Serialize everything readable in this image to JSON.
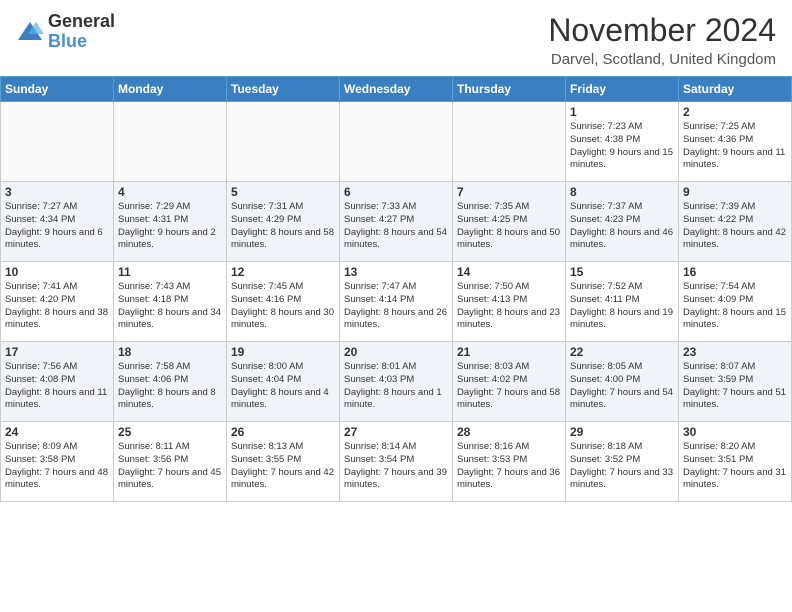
{
  "header": {
    "logo_line1": "General",
    "logo_line2": "Blue",
    "title": "November 2024",
    "location": "Darvel, Scotland, United Kingdom"
  },
  "weekdays": [
    "Sunday",
    "Monday",
    "Tuesday",
    "Wednesday",
    "Thursday",
    "Friday",
    "Saturday"
  ],
  "weeks": [
    [
      {
        "date": "",
        "info": ""
      },
      {
        "date": "",
        "info": ""
      },
      {
        "date": "",
        "info": ""
      },
      {
        "date": "",
        "info": ""
      },
      {
        "date": "",
        "info": ""
      },
      {
        "date": "1",
        "info": "Sunrise: 7:23 AM\nSunset: 4:38 PM\nDaylight: 9 hours and 15 minutes."
      },
      {
        "date": "2",
        "info": "Sunrise: 7:25 AM\nSunset: 4:36 PM\nDaylight: 9 hours and 11 minutes."
      }
    ],
    [
      {
        "date": "3",
        "info": "Sunrise: 7:27 AM\nSunset: 4:34 PM\nDaylight: 9 hours and 6 minutes."
      },
      {
        "date": "4",
        "info": "Sunrise: 7:29 AM\nSunset: 4:31 PM\nDaylight: 9 hours and 2 minutes."
      },
      {
        "date": "5",
        "info": "Sunrise: 7:31 AM\nSunset: 4:29 PM\nDaylight: 8 hours and 58 minutes."
      },
      {
        "date": "6",
        "info": "Sunrise: 7:33 AM\nSunset: 4:27 PM\nDaylight: 8 hours and 54 minutes."
      },
      {
        "date": "7",
        "info": "Sunrise: 7:35 AM\nSunset: 4:25 PM\nDaylight: 8 hours and 50 minutes."
      },
      {
        "date": "8",
        "info": "Sunrise: 7:37 AM\nSunset: 4:23 PM\nDaylight: 8 hours and 46 minutes."
      },
      {
        "date": "9",
        "info": "Sunrise: 7:39 AM\nSunset: 4:22 PM\nDaylight: 8 hours and 42 minutes."
      }
    ],
    [
      {
        "date": "10",
        "info": "Sunrise: 7:41 AM\nSunset: 4:20 PM\nDaylight: 8 hours and 38 minutes."
      },
      {
        "date": "11",
        "info": "Sunrise: 7:43 AM\nSunset: 4:18 PM\nDaylight: 8 hours and 34 minutes."
      },
      {
        "date": "12",
        "info": "Sunrise: 7:45 AM\nSunset: 4:16 PM\nDaylight: 8 hours and 30 minutes."
      },
      {
        "date": "13",
        "info": "Sunrise: 7:47 AM\nSunset: 4:14 PM\nDaylight: 8 hours and 26 minutes."
      },
      {
        "date": "14",
        "info": "Sunrise: 7:50 AM\nSunset: 4:13 PM\nDaylight: 8 hours and 23 minutes."
      },
      {
        "date": "15",
        "info": "Sunrise: 7:52 AM\nSunset: 4:11 PM\nDaylight: 8 hours and 19 minutes."
      },
      {
        "date": "16",
        "info": "Sunrise: 7:54 AM\nSunset: 4:09 PM\nDaylight: 8 hours and 15 minutes."
      }
    ],
    [
      {
        "date": "17",
        "info": "Sunrise: 7:56 AM\nSunset: 4:08 PM\nDaylight: 8 hours and 11 minutes."
      },
      {
        "date": "18",
        "info": "Sunrise: 7:58 AM\nSunset: 4:06 PM\nDaylight: 8 hours and 8 minutes."
      },
      {
        "date": "19",
        "info": "Sunrise: 8:00 AM\nSunset: 4:04 PM\nDaylight: 8 hours and 4 minutes."
      },
      {
        "date": "20",
        "info": "Sunrise: 8:01 AM\nSunset: 4:03 PM\nDaylight: 8 hours and 1 minute."
      },
      {
        "date": "21",
        "info": "Sunrise: 8:03 AM\nSunset: 4:02 PM\nDaylight: 7 hours and 58 minutes."
      },
      {
        "date": "22",
        "info": "Sunrise: 8:05 AM\nSunset: 4:00 PM\nDaylight: 7 hours and 54 minutes."
      },
      {
        "date": "23",
        "info": "Sunrise: 8:07 AM\nSunset: 3:59 PM\nDaylight: 7 hours and 51 minutes."
      }
    ],
    [
      {
        "date": "24",
        "info": "Sunrise: 8:09 AM\nSunset: 3:58 PM\nDaylight: 7 hours and 48 minutes."
      },
      {
        "date": "25",
        "info": "Sunrise: 8:11 AM\nSunset: 3:56 PM\nDaylight: 7 hours and 45 minutes."
      },
      {
        "date": "26",
        "info": "Sunrise: 8:13 AM\nSunset: 3:55 PM\nDaylight: 7 hours and 42 minutes."
      },
      {
        "date": "27",
        "info": "Sunrise: 8:14 AM\nSunset: 3:54 PM\nDaylight: 7 hours and 39 minutes."
      },
      {
        "date": "28",
        "info": "Sunrise: 8:16 AM\nSunset: 3:53 PM\nDaylight: 7 hours and 36 minutes."
      },
      {
        "date": "29",
        "info": "Sunrise: 8:18 AM\nSunset: 3:52 PM\nDaylight: 7 hours and 33 minutes."
      },
      {
        "date": "30",
        "info": "Sunrise: 8:20 AM\nSunset: 3:51 PM\nDaylight: 7 hours and 31 minutes."
      }
    ]
  ]
}
